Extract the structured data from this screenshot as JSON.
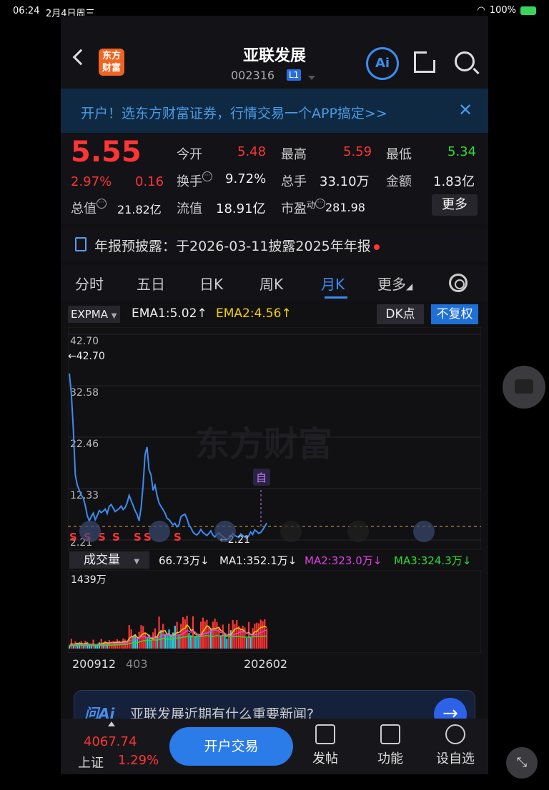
{
  "status": {
    "time": "06:24",
    "date": "2月4日周三",
    "battery": "100%"
  },
  "header": {
    "title": "亚联发展",
    "code": "002316",
    "level": "L1",
    "logo_line1": "东方",
    "logo_line2": "财富",
    "ai": "Ai"
  },
  "banner": {
    "text": "开户！选东方财富证券，行情交易一个APP搞定>>",
    "close": "✕"
  },
  "quote": {
    "price": "5.55",
    "change_pct": "2.97%",
    "change": "0.16",
    "open_label": "今开",
    "open": "5.48",
    "high_label": "最高",
    "high": "5.59",
    "low_label": "最低",
    "low": "5.34",
    "turnover_label": "换手",
    "turnover": "9.72%",
    "volume_label": "总手",
    "volume": "33.10万",
    "amount_label": "金额",
    "amount": "1.83亿",
    "mcap_label": "总值",
    "mcap": "21.82亿",
    "float_label": "流值",
    "float": "18.91亿",
    "pe_label": "市盈",
    "pe_sup": "动",
    "pe": "281.98",
    "more": "更多"
  },
  "notice": {
    "text": "年报预披露：于2026-03-11披露2025年年报"
  },
  "tabs": [
    "分时",
    "五日",
    "日K",
    "周K",
    "月K",
    "更多"
  ],
  "active_tab": "月K",
  "indicator": {
    "name": "EXPMA",
    "ema1": "EMA1:5.02",
    "ema2": "EMA2:4.56",
    "dk": "DK点",
    "fq": "不复权",
    "ema1_color": "#ffffff",
    "ema2_color": "#f5d000"
  },
  "chart_data": {
    "type": "line",
    "title": "",
    "xlabel": "",
    "ylabel": "",
    "y_ticks": [
      "42.70",
      "32.58",
      "22.46",
      "12.33",
      "2.21"
    ],
    "ylim": [
      2.21,
      42.7
    ],
    "max_label": "←42.70",
    "min_label": "←2.21",
    "marker": "自",
    "series": [
      {
        "values": [
          35,
          31,
          24,
          15,
          13,
          12,
          11,
          10.5,
          9,
          7,
          6,
          6.8,
          7.5,
          6.2,
          7,
          8,
          7.6,
          7.9,
          8.3,
          7.4,
          8.8,
          9.2,
          8.5,
          7.8,
          8.1,
          8.4,
          8.9,
          8.2,
          8.6,
          9.5,
          11,
          10,
          9,
          8,
          7.2,
          6,
          8.5,
          13,
          19,
          20.5,
          16,
          15,
          12,
          13,
          11,
          9.5,
          8.8,
          8.2,
          7.5,
          6.5,
          6.2,
          5.7,
          5.2,
          5.5,
          4.8,
          5.2,
          6.8,
          7.1,
          7.3,
          6.4,
          5.2,
          4.6,
          3.8,
          3.4,
          3.2,
          3.6,
          4.3,
          3.7,
          3.4,
          3.1,
          3.5,
          4,
          3.2,
          2.8,
          3.3,
          3.6,
          3.2,
          2.9,
          2.6,
          2.3,
          2.5,
          2.9,
          3.5,
          3.1,
          2.9,
          2.7,
          3.4,
          3.1,
          2.8,
          2.6,
          3,
          3.8,
          3.3,
          4.2,
          3.9,
          3.5,
          3.7,
          4.2,
          4.8,
          5.55
        ]
      }
    ]
  },
  "volume": {
    "selector": "成交量",
    "value": "66.73万",
    "ma1": "MA1:352.1万",
    "ma2": "MA2:323.0万",
    "ma3": "MA3:324.3万",
    "max_label": "1439万",
    "ma1_color": "#ffffff",
    "ma2_color": "#e040e0",
    "ma3_color": "#2fdc2f"
  },
  "dates": {
    "start": "200912",
    "mid": "403",
    "end": "202602"
  },
  "ask": {
    "logo": "问Ai",
    "text": "亚联发展近期有什么重要新闻?"
  },
  "bottom": {
    "index_value": "4067.74",
    "index_name": "上证",
    "index_change": "1.29%",
    "trade": "开户交易",
    "post": "发帖",
    "func": "功能",
    "watch": "设自选"
  }
}
